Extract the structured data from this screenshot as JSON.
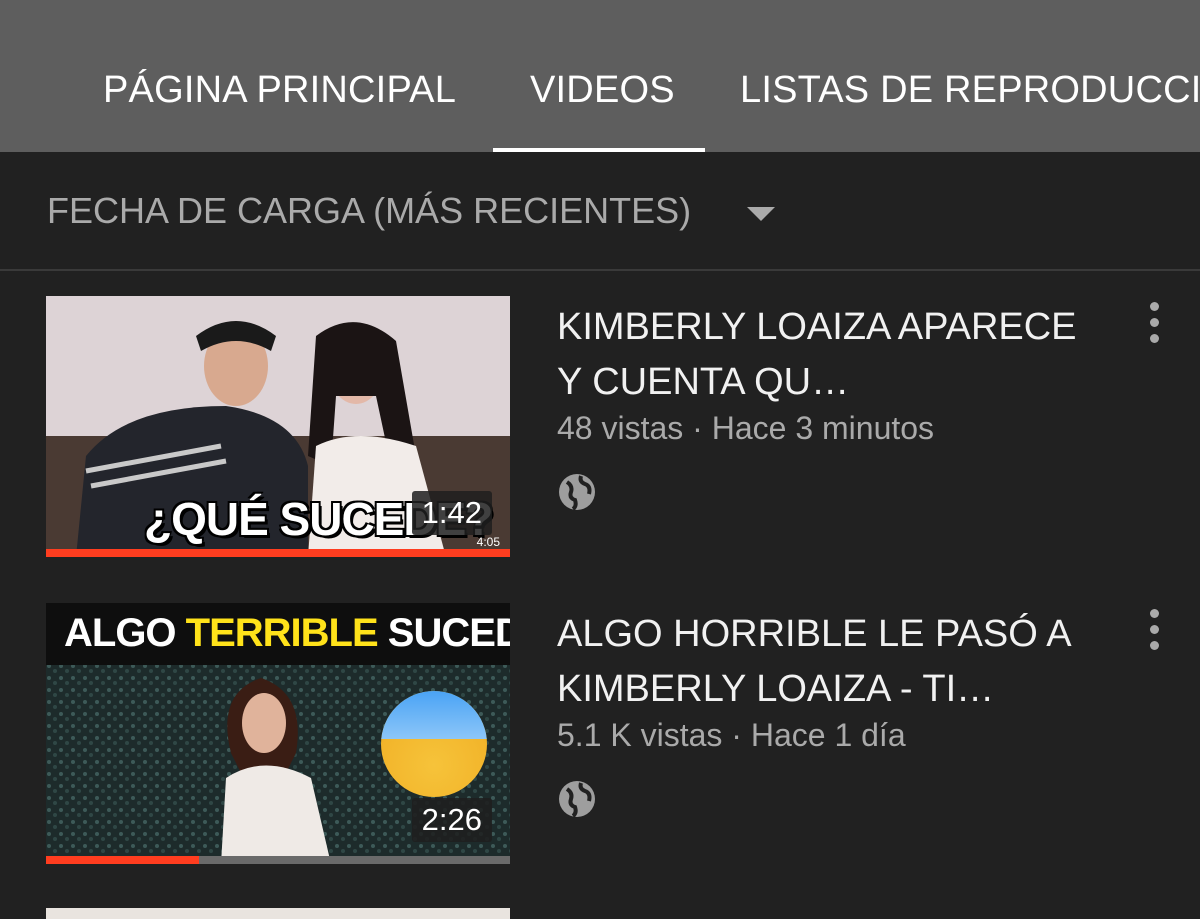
{
  "tabs": [
    {
      "label": "PÁGINA PRINCIPAL",
      "active": false
    },
    {
      "label": "VIDEOS",
      "active": true
    },
    {
      "label": "LISTAS DE REPRODUCCIÓN",
      "active": false
    }
  ],
  "sort": {
    "label": "FECHA DE CARGA (MÁS RECIENTES)",
    "icon": "caret-down-icon"
  },
  "videos": [
    {
      "title": "KIMBERLY LOAIZA APARECE Y CUENTA QU…",
      "meta": "48 vistas · Hace 3 minutos",
      "duration": "1:42",
      "thumb_small_duration": "4:05",
      "thumb_caption": "¿QUÉ SUCEDE?",
      "progress": 1.0,
      "visibility_icon": "globe-icon"
    },
    {
      "title": "ALGO HORRIBLE LE PASÓ A KIMBERLY LOAIZA - TI…",
      "meta": "5.1 K vistas · Hace 1 día",
      "duration": "2:26",
      "thumb_caption_a": "ALGO",
      "thumb_caption_b": "TERRIBLE",
      "thumb_caption_c": "SUCEDIÓ",
      "progress": 0.33,
      "visibility_icon": "globe-icon"
    }
  ],
  "colors": {
    "tab_bar": "#5e5e5e",
    "background": "#212121",
    "progress": "#ff3d1f"
  }
}
